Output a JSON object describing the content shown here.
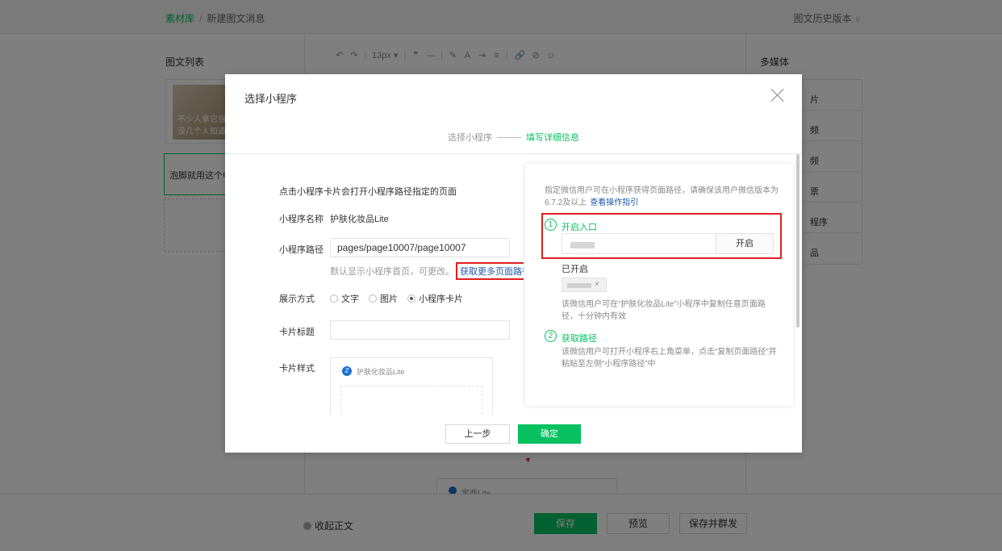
{
  "breadcrumb": {
    "root": "素材库",
    "separator": "/",
    "current": "新建图文消息"
  },
  "history_label": "图文历史版本",
  "article_list": {
    "title": "图文列表",
    "card1_text_line1": "不少人拿它当",
    "card1_text_line2": "没几个人知道",
    "card2_text": "泡脚就用这个中",
    "add_symbol": "—"
  },
  "editor": {
    "toolbar": {
      "undo": "↶",
      "redo": "↷",
      "font_size": "13px ▾",
      "quote": "❞",
      "hr": "—",
      "brush": "✎",
      "bold_a": "A",
      "indent": "⇥",
      "align": "≡",
      "link": "🔗",
      "unlink": "⊘",
      "emoji": "☺"
    },
    "arrow": "▼",
    "mini_card_name": "家西Lite"
  },
  "media": {
    "title": "多媒体",
    "items": [
      "片",
      "频",
      "频",
      "票",
      "程序",
      "品"
    ]
  },
  "footer": {
    "collapse_label": "收起正文",
    "save": "保存",
    "preview": "预览",
    "save_send": "保存并群发"
  },
  "dialog": {
    "title": "选择小程序",
    "steps": {
      "step1": "选择小程序",
      "step2": "填写详细信息"
    },
    "intro": "点击小程序卡片会打开小程序路径指定的页面",
    "name_label": "小程序名称",
    "name_value": "护肤化妆品Lite",
    "path_label": "小程序路径",
    "path_value": "pages/page10007/page10007",
    "path_hint": "默认显示小程序首页，可更改。",
    "more_paths_link": "获取更多页面路径",
    "display_label": "展示方式",
    "display_options": {
      "text": "文字",
      "image": "图片",
      "card": "小程序卡片"
    },
    "card_title_label": "卡片标题",
    "card_style_label": "卡片样式",
    "card_preview_name": "护肤化妆品Lite",
    "guide": {
      "desc": "指定微信用户可在小程序获得页面路径，请确保该用户微信版本为6.7.2及以上",
      "guide_link": "查看操作指引",
      "step1_num": "1",
      "step1_title": "开启入口",
      "open_button": "开启",
      "opened_label": "已开启",
      "tag_close": "×",
      "step1_note": "该微信用户可在“护肤化妆品Lite”小程序中复制任意页面路径，十分钟内有效",
      "step2_num": "2",
      "step2_title": "获取路径",
      "step2_note": "该微信用户可打开小程序右上角菜单，点击“复制页面路径”并粘贴至左侧“小程序路径”中"
    },
    "prev_button": "上一步",
    "confirm_button": "确定"
  },
  "colors": {
    "accent": "#07c160",
    "highlight_border": "#e02020",
    "link": "#1f59a8"
  }
}
